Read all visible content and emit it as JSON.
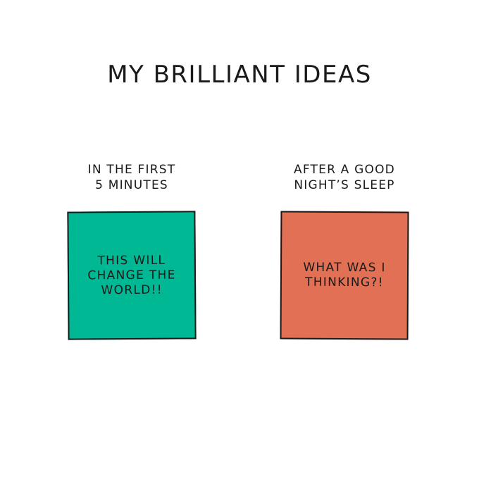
{
  "title": "MY BRILLIANT IDEAS",
  "colors": {
    "left_note": "#00b894",
    "right_note": "#e17055",
    "ink": "#1a1a1a"
  },
  "panels": [
    {
      "caption_lines": [
        "IN THE FIRST",
        "5 MINUTES"
      ],
      "note_lines": [
        "THIS WILL",
        "CHANGE THE",
        "WORLD!!"
      ]
    },
    {
      "caption_lines": [
        "AFTER A GOOD",
        "NIGHT’S SLEEP"
      ],
      "note_lines": [
        "WHAT WAS I",
        "THINKING?!"
      ]
    }
  ]
}
